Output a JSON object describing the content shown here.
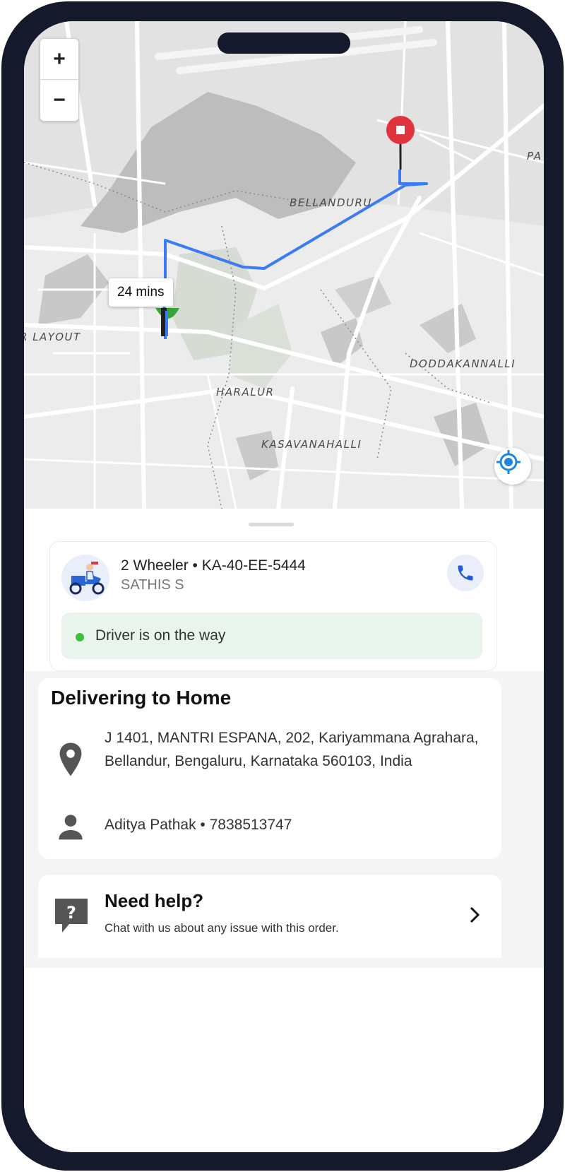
{
  "map": {
    "places": [
      "BELLANDURU",
      "R LAYOUT",
      "DODDAKANNALLI",
      "HARALUR",
      "KASAVANAHALLI",
      "PA"
    ],
    "zoom_in": "+",
    "zoom_out": "−",
    "eta_label": "24 mins",
    "route_color": "#3a7cf5",
    "destination_color": "#e0323f"
  },
  "driver": {
    "vehicle": "2 Wheeler • KA-40-EE-5444",
    "name": "SATHIS S",
    "status": "Driver is on the way"
  },
  "delivery": {
    "title": "Delivering to Home",
    "address": "J 1401, MANTRI ESPANA, 202, Kariyammana Agrahara, Bellandur, Bengaluru, Karnataka 560103, India",
    "contact": "Aditya Pathak • 7838513747"
  },
  "help": {
    "title": "Need help?",
    "subtitle": "Chat with us about any issue with this order."
  },
  "icons": {
    "call": "phone-icon",
    "location": "location-pin-icon",
    "person": "person-icon",
    "help": "chat-question-icon",
    "chevron": "chevron-right-icon",
    "my_location": "my-location-icon"
  }
}
